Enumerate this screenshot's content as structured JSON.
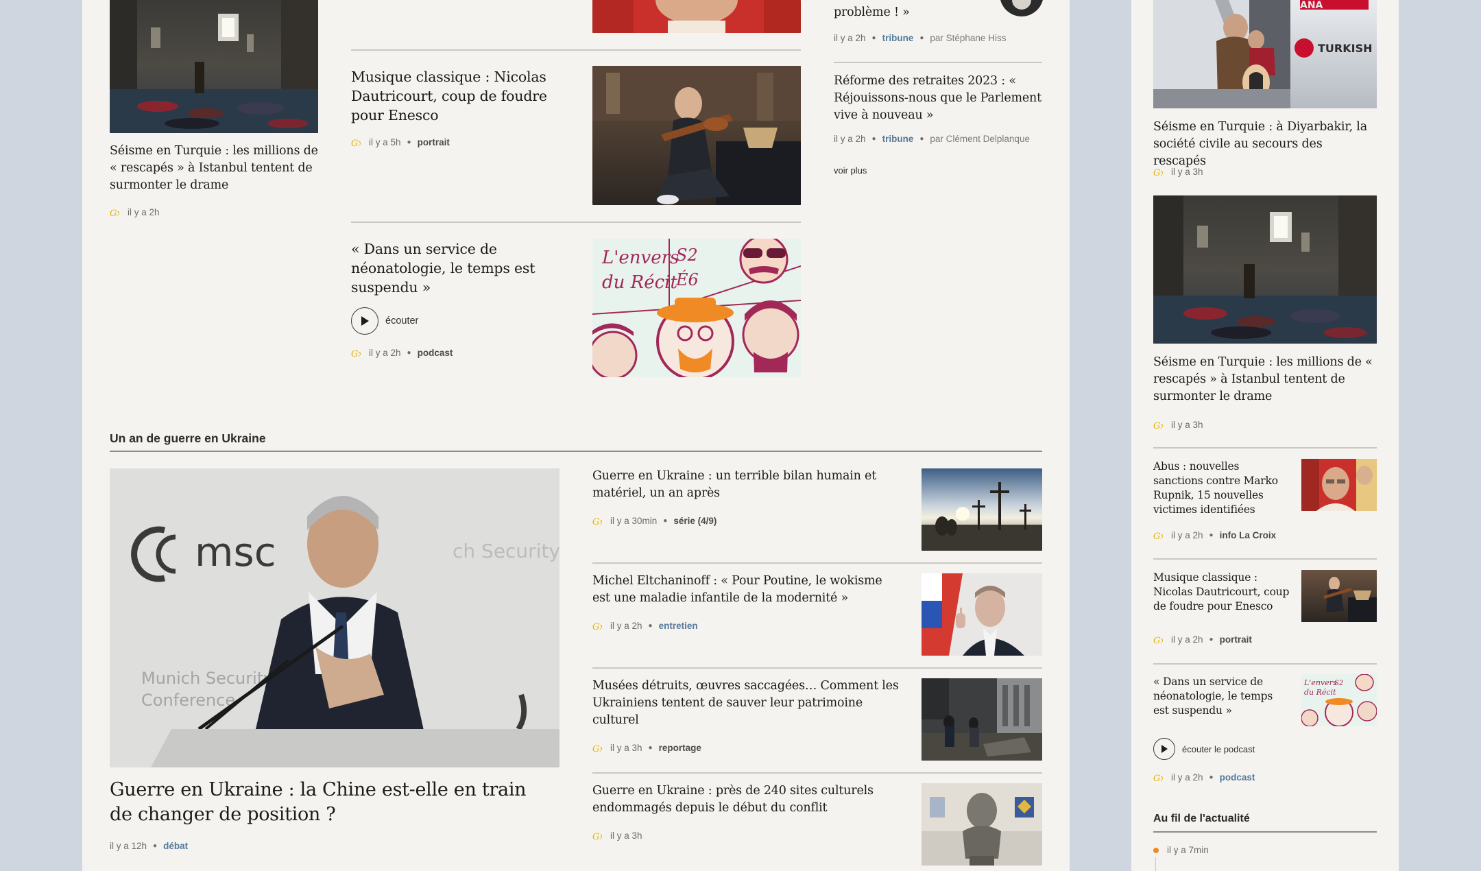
{
  "colors": {
    "accent_gold": "#e4b500",
    "tag_blue": "#557a9c",
    "orange_dot": "#f08a24"
  },
  "top_left": {
    "title": "Séisme en Turquie : les millions de « rescapés » à Istanbul tentent de surmonter le drame",
    "time": "il y a 2h",
    "image": "mosque-shelter-photo"
  },
  "mid_column": {
    "items": [
      {
        "title": "Musique classique : Nicolas Dautricourt, coup de foudre pour Enesco",
        "time": "il y a 5h",
        "tag": "portrait",
        "image": "violinist-photo"
      },
      {
        "title": "« Dans un service de néonatologie, le temps est suspendu »",
        "listen": "écouter",
        "time": "il y a 2h",
        "tag": "podcast",
        "image": "podcast-illustration"
      }
    ]
  },
  "opinion_column": {
    "top_title_fragment": "problème ! »",
    "items": [
      {
        "time": "il y a 2h",
        "tag": "tribune",
        "byline": "par Stéphane Hiss"
      },
      {
        "title": "Réforme des retraites 2023 : « Réjouissons-nous que le Parlement vive à nouveau »",
        "time": "il y a 2h",
        "tag": "tribune",
        "byline": "par Clément Delplanque"
      }
    ],
    "more": "voir plus"
  },
  "ukraine": {
    "section_title": "Un an de guerre en Ukraine",
    "lead": {
      "title": "Guerre en Ukraine : la Chine est-elle en train de changer de position ?",
      "time": "il y a 12h",
      "tag": "débat",
      "image": "wang-yi-munich-photo",
      "podium_text_1": "msc",
      "podium_text_2": "Munich Security",
      "podium_text_3": "Conference",
      "bg_text": "ch Security"
    },
    "items": [
      {
        "title": "Guerre en Ukraine : un terrible bilan humain et matériel, un an après",
        "time": "il y a 30min",
        "tag": "série (4/9)",
        "image": "graves-sunset-photo"
      },
      {
        "title": "Michel Eltchaninoff : « Pour Poutine, le wokisme est une maladie infantile de la modernité »",
        "time": "il y a 2h",
        "tag": "entretien",
        "image": "putin-photo"
      },
      {
        "title": "Musées détruits, œuvres saccagées… Comment les Ukrainiens tentent de sauver leur patrimoine culturel",
        "time": "il y a 3h",
        "tag": "reportage",
        "image": "museum-rubble-photo"
      },
      {
        "title": "Guerre en Ukraine : près de 240 sites culturels endommagés depuis le début du conflit",
        "time": "il y a 3h",
        "image": "bust-statue-photo"
      }
    ]
  },
  "sidebar": {
    "items": [
      {
        "title": "Séisme en Turquie : à Diyarbakir, la société civile au secours des rescapés",
        "time": "il y a 3h",
        "image": "airplane-refugees-photo",
        "plane_text": "TURKISH"
      },
      {
        "title": "Séisme en Turquie : les millions de « rescapés » à Istanbul tentent de surmonter le drame",
        "time": "il y a 3h",
        "image": "mosque-shelter-photo"
      },
      {
        "title": "Abus : nouvelles sanctions contre Marko Rupnik, 15 nouvelles victimes identifiées",
        "time": "il y a 2h",
        "tag": "info La Croix",
        "image": "rupnik-photo"
      },
      {
        "title": "Musique classique : Nicolas Dautricourt, coup de foudre pour Enesco",
        "time": "il y a 2h",
        "tag": "portrait",
        "image": "violinist-photo"
      },
      {
        "title": "« Dans un service de néonatologie, le temps est suspendu »",
        "listen": "écouter le podcast",
        "time": "il y a 2h",
        "tag": "podcast",
        "image": "podcast-illustration"
      }
    ],
    "live_title": "Au fil de l'actualité",
    "live_first_time": "il y a 7min"
  }
}
